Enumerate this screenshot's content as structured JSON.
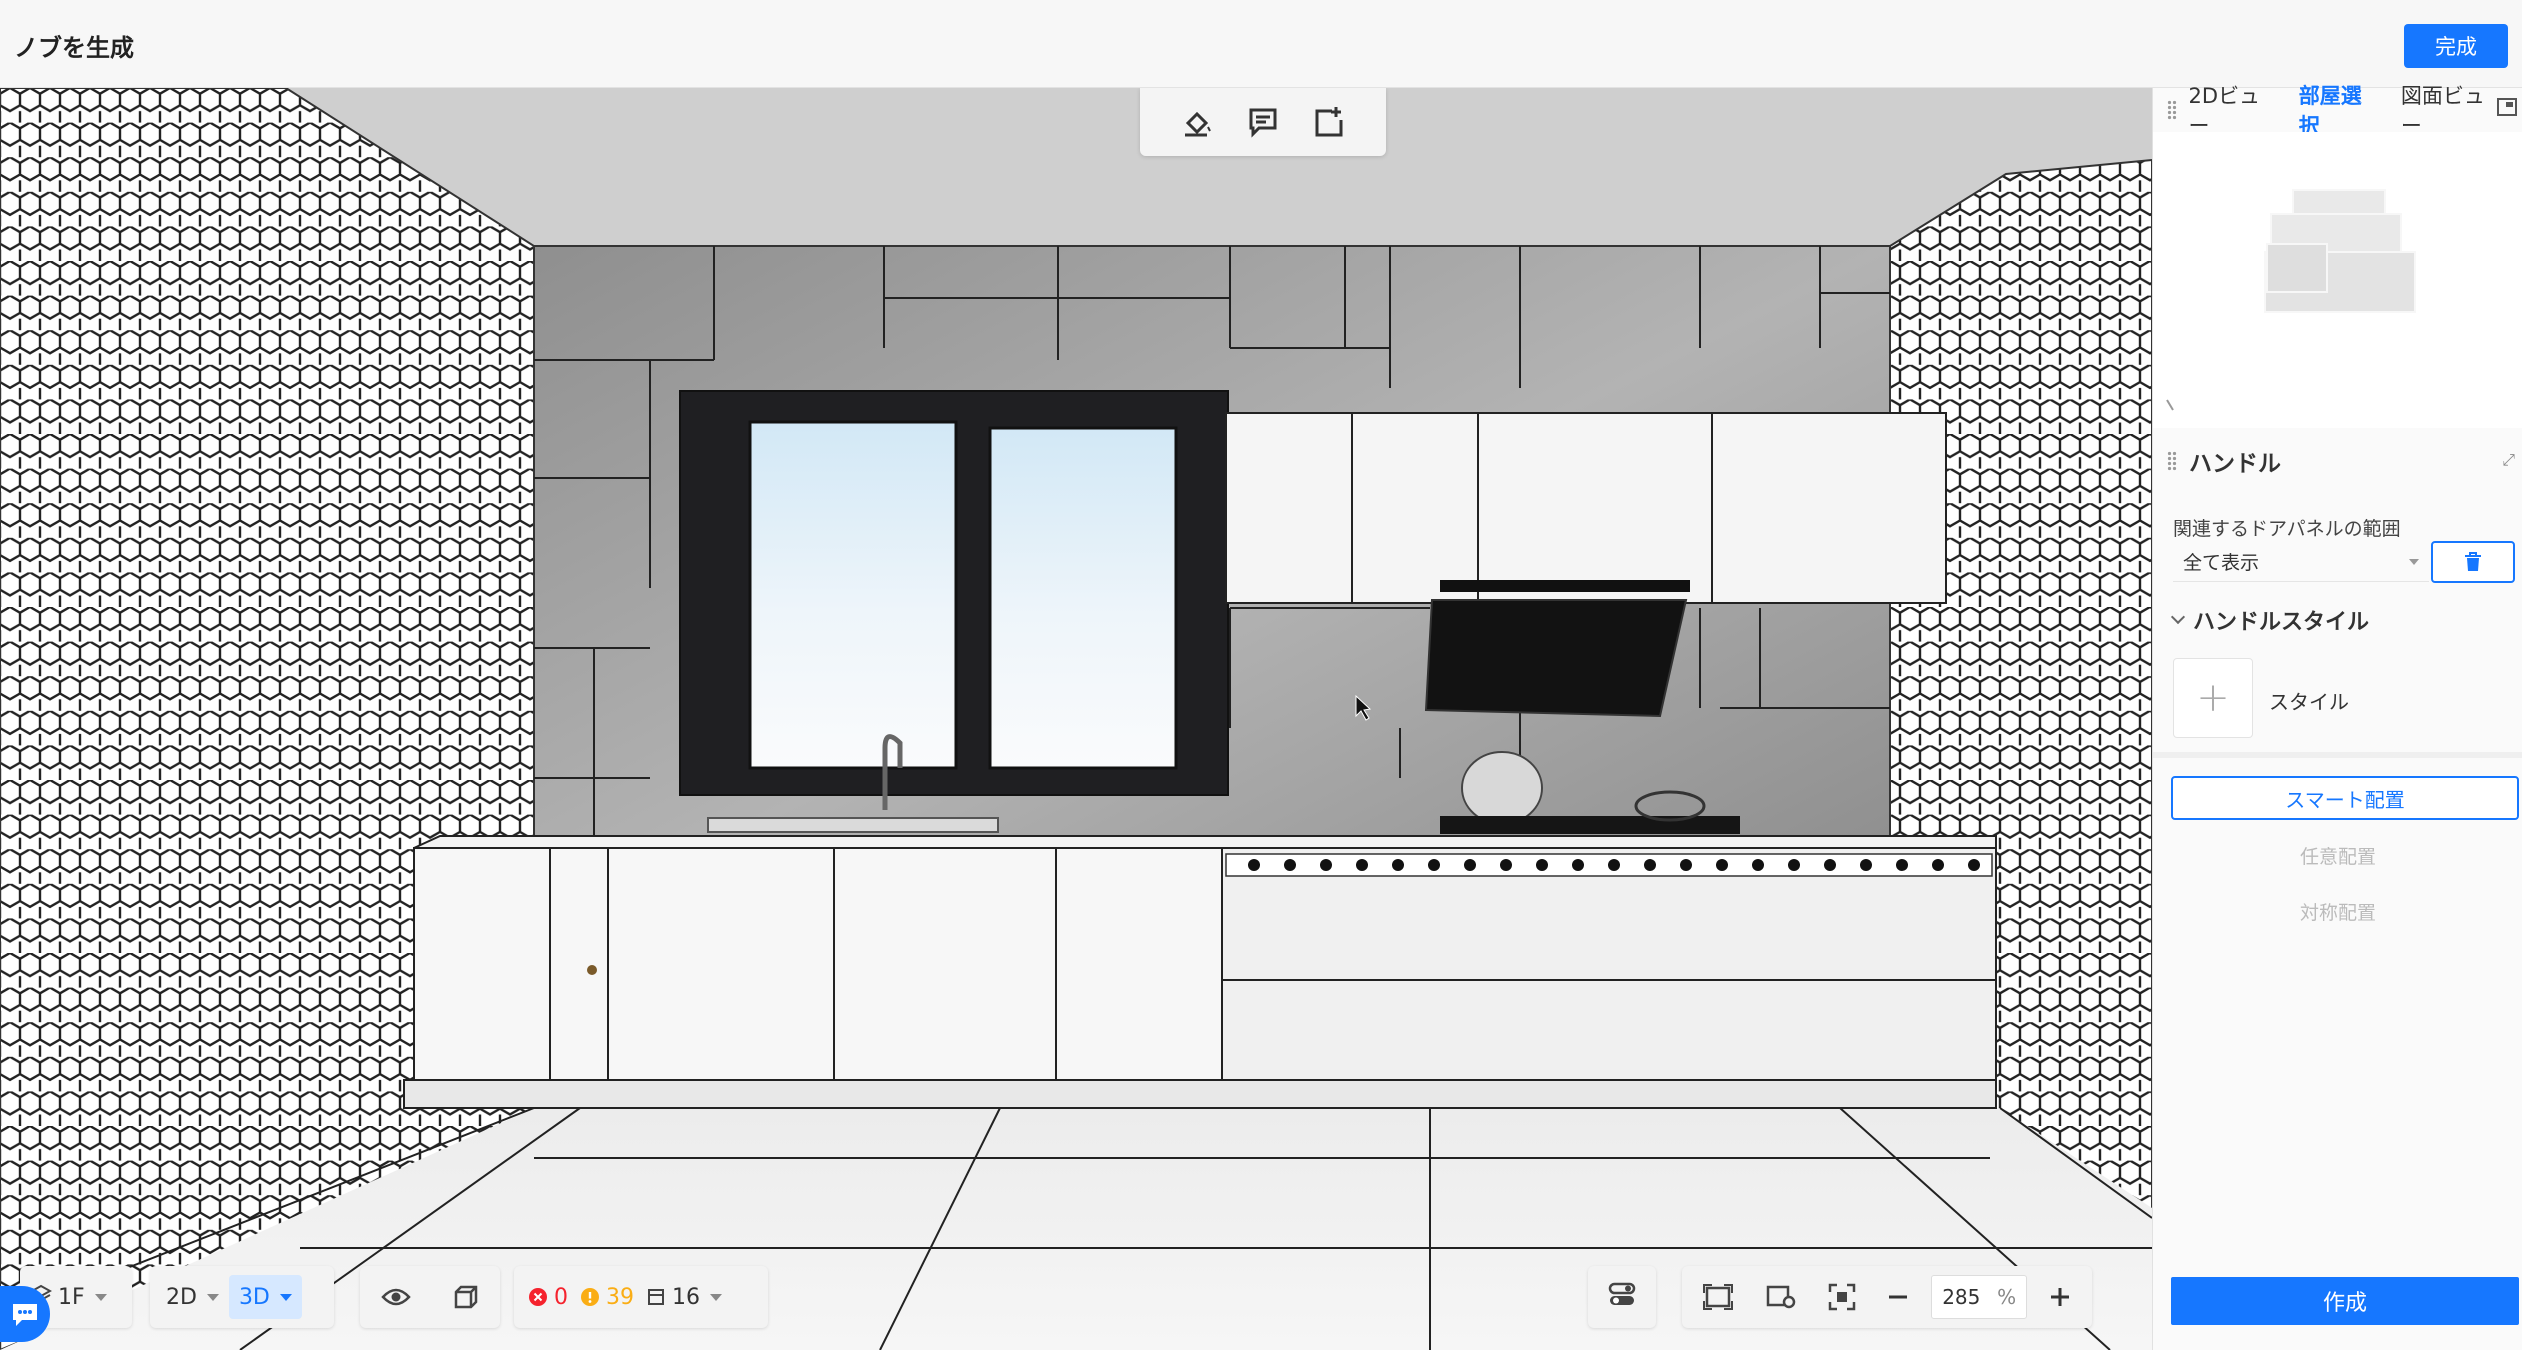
{
  "header": {
    "title": "ノブを生成",
    "done_label": "完成"
  },
  "floating_toolbar": {
    "icons": [
      "paint-bucket-icon",
      "comment-icon",
      "add-frame-icon"
    ]
  },
  "right_panel": {
    "view_tabs": [
      "2Dビュー",
      "部屋選択",
      "図面ビュー"
    ],
    "active_tab": "部屋選択",
    "handle_panel": {
      "title": "ハンドル",
      "range_label": "関連するドアパネルの範囲",
      "range_value": "全て表示",
      "style_section_title": "ハンドルスタイル",
      "style_label": "スタイル",
      "smart_place_label": "スマート配置",
      "free_place_label": "任意配置",
      "symmetric_place_label": "対称配置",
      "create_label": "作成"
    }
  },
  "bottom_toolbar": {
    "floor": "1F",
    "mode_2d": "2D",
    "mode_3d": "3D",
    "error_count": "0",
    "warning_count": "39",
    "item_count": "16",
    "zoom_value": "285",
    "zoom_unit": "%"
  },
  "colors": {
    "accent": "#1677ff",
    "error": "#f5222d",
    "warning": "#faad14"
  }
}
